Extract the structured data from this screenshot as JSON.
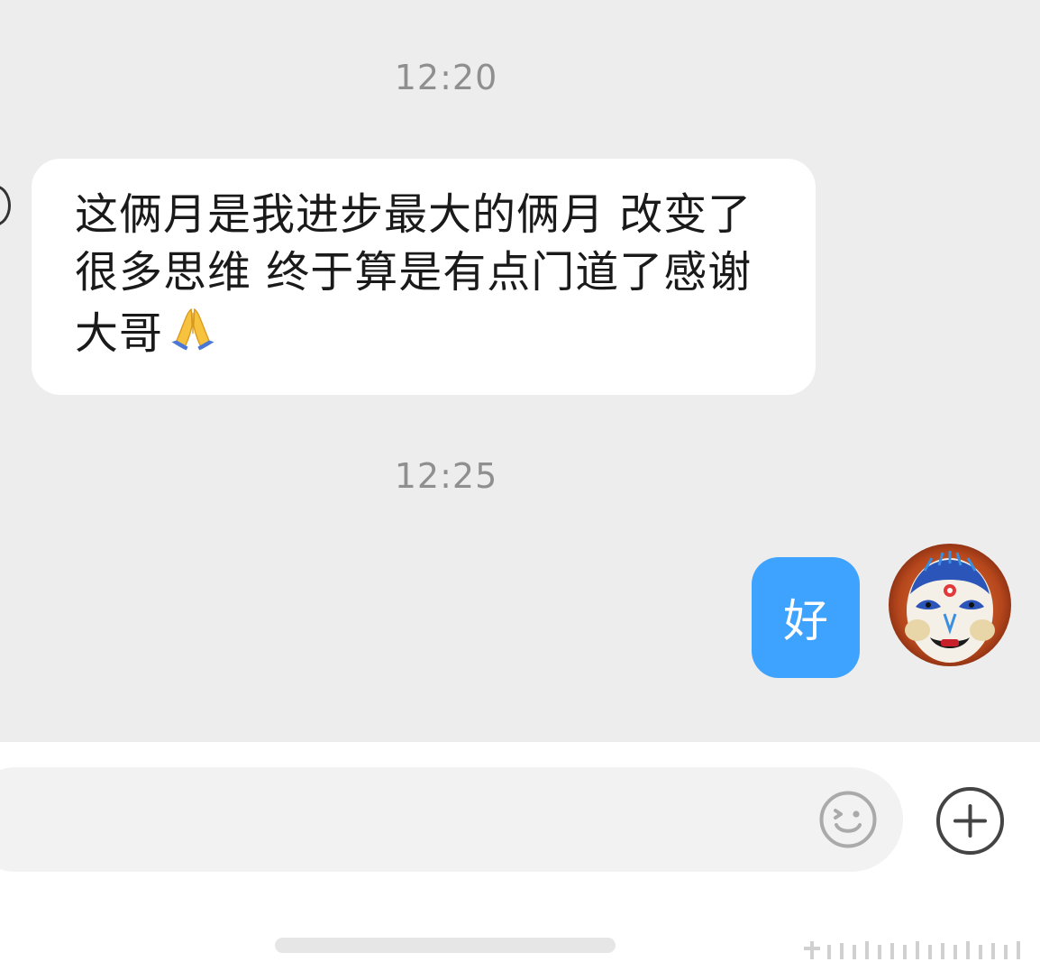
{
  "chat": {
    "timestamps": [
      "12:20",
      "12:25"
    ],
    "messages": [
      {
        "direction": "incoming",
        "text": "这俩月是我进步最大的俩月 改变了很多思维 终于算是有点门道了感谢大哥",
        "emoji": "folded-hands"
      },
      {
        "direction": "outgoing",
        "text": "好"
      }
    ]
  },
  "input": {
    "value": "",
    "placeholder": ""
  },
  "icons": {
    "emoji_button": "smiley-icon",
    "more_button": "plus-circle-icon"
  },
  "colors": {
    "chat_background": "#ededed",
    "incoming_bubble": "#ffffff",
    "outgoing_bubble": "#3ea2ff",
    "timestamp_text": "#8f8f8f",
    "input_background": "#f2f2f2"
  }
}
